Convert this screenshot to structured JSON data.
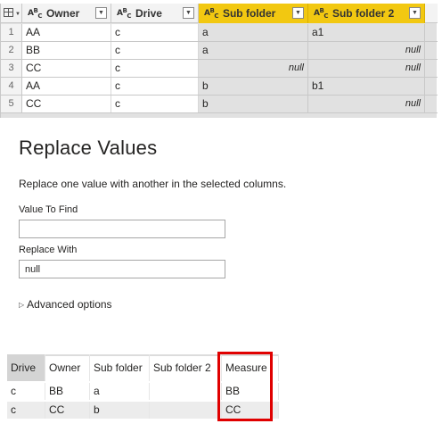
{
  "query_grid": {
    "columns": [
      {
        "name": "Owner",
        "type_icon": "abc-text-type-icon",
        "selected": false
      },
      {
        "name": "Drive",
        "type_icon": "abc-text-type-icon",
        "selected": false
      },
      {
        "name": "Sub folder",
        "type_icon": "abc-text-type-icon",
        "selected": true
      },
      {
        "name": "Sub folder 2",
        "type_icon": "abc-text-type-icon",
        "selected": true
      }
    ],
    "rows": [
      {
        "num": "1",
        "cells": [
          "AA",
          "c",
          "a",
          "a1"
        ]
      },
      {
        "num": "2",
        "cells": [
          "BB",
          "c",
          "a",
          "null"
        ]
      },
      {
        "num": "3",
        "cells": [
          "CC",
          "c",
          "null",
          "null"
        ]
      },
      {
        "num": "4",
        "cells": [
          "AA",
          "c",
          "b",
          "b1"
        ]
      },
      {
        "num": "5",
        "cells": [
          "CC",
          "c",
          "b",
          "null"
        ]
      }
    ],
    "highlight_color": "#f2c811"
  },
  "dialog": {
    "title": "Replace Values",
    "description": "Replace one value with another in the selected columns.",
    "value_to_find_label": "Value To Find",
    "value_to_find_value": "",
    "replace_with_label": "Replace With",
    "replace_with_value": "null",
    "advanced_options_label": "Advanced options"
  },
  "result_table": {
    "headers": [
      "Drive",
      "Owner",
      "Sub folder",
      "Sub folder 2",
      "Measure"
    ],
    "rows": [
      [
        "c",
        "BB",
        "a",
        "",
        "BB"
      ],
      [
        "c",
        "CC",
        "b",
        "",
        "CC"
      ]
    ],
    "highlight_border_color": "#e00000"
  }
}
